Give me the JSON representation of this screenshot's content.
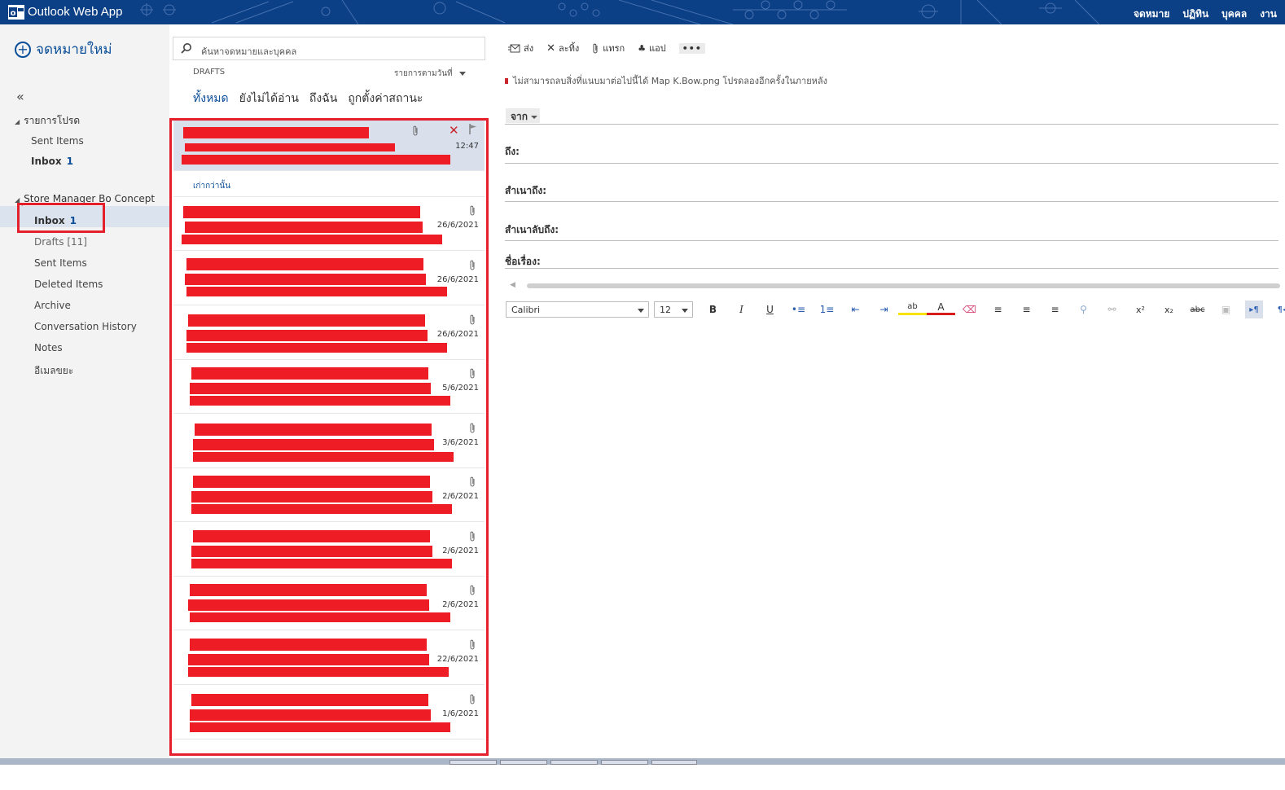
{
  "header": {
    "app_title": "Outlook Web App",
    "nav": [
      {
        "label": "จดหมาย",
        "active": true
      },
      {
        "label": "ปฏิทิน",
        "active": false
      },
      {
        "label": "บุคคล",
        "active": false
      },
      {
        "label": "งาน",
        "active": false
      }
    ],
    "bg_color": "#0b3f86"
  },
  "sidebar": {
    "new_mail_label": "จดหมายใหม่",
    "collapse_glyph": "«",
    "favorites_label": "รายการโปรด",
    "favorites": [
      {
        "label": "Sent Items",
        "count": ""
      },
      {
        "label": "Inbox",
        "count": "1"
      }
    ],
    "mailbox_label": "Store Manager Bo Concept Siam",
    "folders": [
      {
        "label": "Inbox",
        "count": "1"
      },
      {
        "label": "Drafts [11]",
        "count": ""
      },
      {
        "label": "Sent Items",
        "count": ""
      },
      {
        "label": "Deleted Items",
        "count": ""
      },
      {
        "label": "Archive",
        "count": ""
      },
      {
        "label": "Conversation History",
        "count": ""
      },
      {
        "label": "Notes",
        "count": ""
      },
      {
        "label": "อีเมลขยะ",
        "count": ""
      }
    ]
  },
  "list": {
    "search_placeholder": "ค้นหาจดหมายและบุคคล",
    "folder_title": "DRAFTS",
    "sort_label": "รายการตามวันที่",
    "filters": [
      "ทั้งหมด",
      "ยังไม่ได้อ่าน",
      "ถึงฉัน",
      "ถูกตั้งค่าสถานะ"
    ],
    "older_label": "เก่ากว่านั้น",
    "selected_time": "12:47",
    "dates": [
      "26/6/2021",
      "26/6/2021",
      "26/6/2021",
      "5/6/2021",
      "3/6/2021",
      "2/6/2021",
      "2/6/2021",
      "2/6/2021",
      "22/6/2021",
      "1/6/2021"
    ]
  },
  "compose": {
    "toolbar": [
      "ส่ง",
      "ละทิ้ง",
      "แทรก",
      "แอป",
      "•••"
    ],
    "warning": "ไม่สามารถลบสิ่งที่แนบมาต่อไปนี้ได้ Map K.Bow.png โปรดลองอีกครั้งในภายหลัง",
    "from_label": "จาก",
    "to_label": "ถึง:",
    "cc_label": "สำเนาถึง:",
    "bcc_label": "สำเนาลับถึง:",
    "subject_label": "ชื่อเรื่อง:",
    "font_name": "Calibri",
    "font_size": "12",
    "format_buttons": [
      "B",
      "I",
      "U",
      "•≡",
      "1≡",
      "⇤",
      "⇥",
      "ab",
      "A",
      "⌫",
      "≡",
      "≡",
      "≡",
      "⚲",
      "⚯",
      "x²",
      "x₂",
      "abc",
      "▣",
      "▸¶",
      "¶◂"
    ]
  },
  "colors": {
    "accent": "#0c4f99",
    "redaction": "#ee1c25",
    "highlight_box": "#e3202b",
    "selected_bg": "#d9e0ec"
  }
}
